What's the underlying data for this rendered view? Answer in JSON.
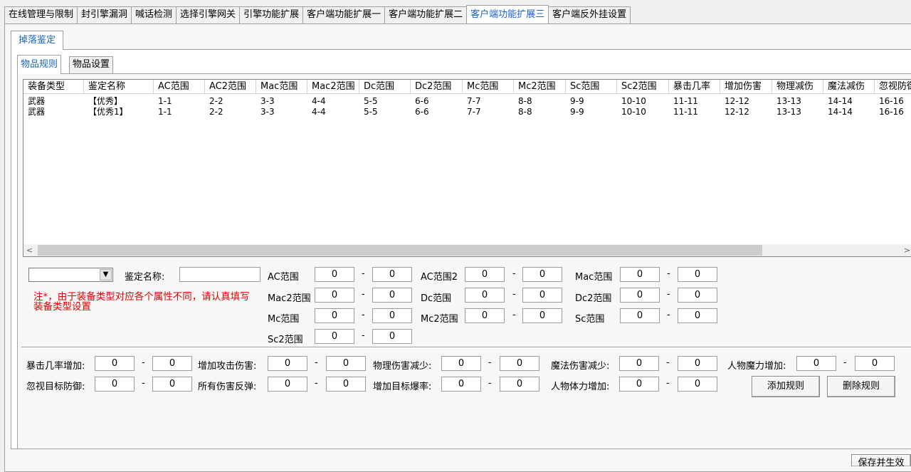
{
  "top_tabs": [
    "在线管理与限制",
    "封引擎漏洞",
    "喊话检测",
    "选择引擎网关",
    "引擎功能扩展",
    "客户端功能扩展一",
    "客户端功能扩展二",
    "客户端功能扩展三",
    "客户端反外挂设置"
  ],
  "sub_tab": "掉落鉴定",
  "inner_tabs": [
    "物品规则",
    "物品设置"
  ],
  "columns": [
    "装备类型",
    "鉴定名称",
    "AC范围",
    "AC2范围",
    "Mac范围",
    "Mac2范围",
    "Dc范围",
    "Dc2范围",
    "Mc范围",
    "Mc2范围",
    "Sc范围",
    "Sc2范围",
    "暴击几率",
    "增加伤害",
    "物理减伤",
    "魔法减伤",
    "忽视防御"
  ],
  "rows": [
    [
      "武器",
      "【优秀】",
      "1-1",
      "2-2",
      "3-3",
      "4-4",
      "5-5",
      "6-6",
      "7-7",
      "8-8",
      "9-9",
      "10-10",
      "11-11",
      "12-12",
      "13-13",
      "14-14",
      "16-16"
    ],
    [
      "武器",
      "【优秀1】",
      "1-1",
      "2-2",
      "3-3",
      "4-4",
      "5-5",
      "6-6",
      "7-7",
      "8-8",
      "9-9",
      "10-10",
      "11-11",
      "12-12",
      "13-13",
      "14-14",
      "16-16"
    ]
  ],
  "form": {
    "equip_type_value": "",
    "identify_name_label": "鉴定名称:",
    "identify_name_value": "",
    "note": "注*，由于装备类型对应各个属性不同，请认真填写装备类型设置",
    "dash": "-",
    "ranges": {
      "ac": {
        "label": "AC范围",
        "min": "0",
        "max": "0"
      },
      "ac2": {
        "label": "AC范围2",
        "min": "0",
        "max": "0"
      },
      "mac": {
        "label": "Mac范围",
        "min": "0",
        "max": "0"
      },
      "mac2": {
        "label": "Mac2范围",
        "min": "0",
        "max": "0"
      },
      "dc": {
        "label": "Dc范围",
        "min": "0",
        "max": "0"
      },
      "dc2": {
        "label": "Dc2范围",
        "min": "0",
        "max": "0"
      },
      "mc": {
        "label": "Mc范围",
        "min": "0",
        "max": "0"
      },
      "mc2": {
        "label": "Mc2范围",
        "min": "0",
        "max": "0"
      },
      "sc": {
        "label": "Sc范围",
        "min": "0",
        "max": "0"
      },
      "sc2": {
        "label": "Sc2范围",
        "min": "0",
        "max": "0"
      }
    },
    "extras": {
      "crit": {
        "label": "暴击几率增加:",
        "min": "0",
        "max": "0"
      },
      "atk": {
        "label": "增加攻击伤害:",
        "min": "0",
        "max": "0"
      },
      "phys": {
        "label": "物理伤害减少:",
        "min": "0",
        "max": "0"
      },
      "magic": {
        "label": "魔法伤害减少:",
        "min": "0",
        "max": "0"
      },
      "mp": {
        "label": "人物魔力增加:",
        "min": "0",
        "max": "0"
      },
      "ignore": {
        "label": "忽视目标防御:",
        "min": "0",
        "max": "0"
      },
      "reflect": {
        "label": "所有伤害反弹:",
        "min": "0",
        "max": "0"
      },
      "burst": {
        "label": "增加目标爆率:",
        "min": "0",
        "max": "0"
      },
      "hp": {
        "label": "人物体力增加:",
        "min": "0",
        "max": "0"
      }
    },
    "add_rule": "添加规则",
    "delete_rule": "删除规则",
    "save": "保存并生效"
  }
}
